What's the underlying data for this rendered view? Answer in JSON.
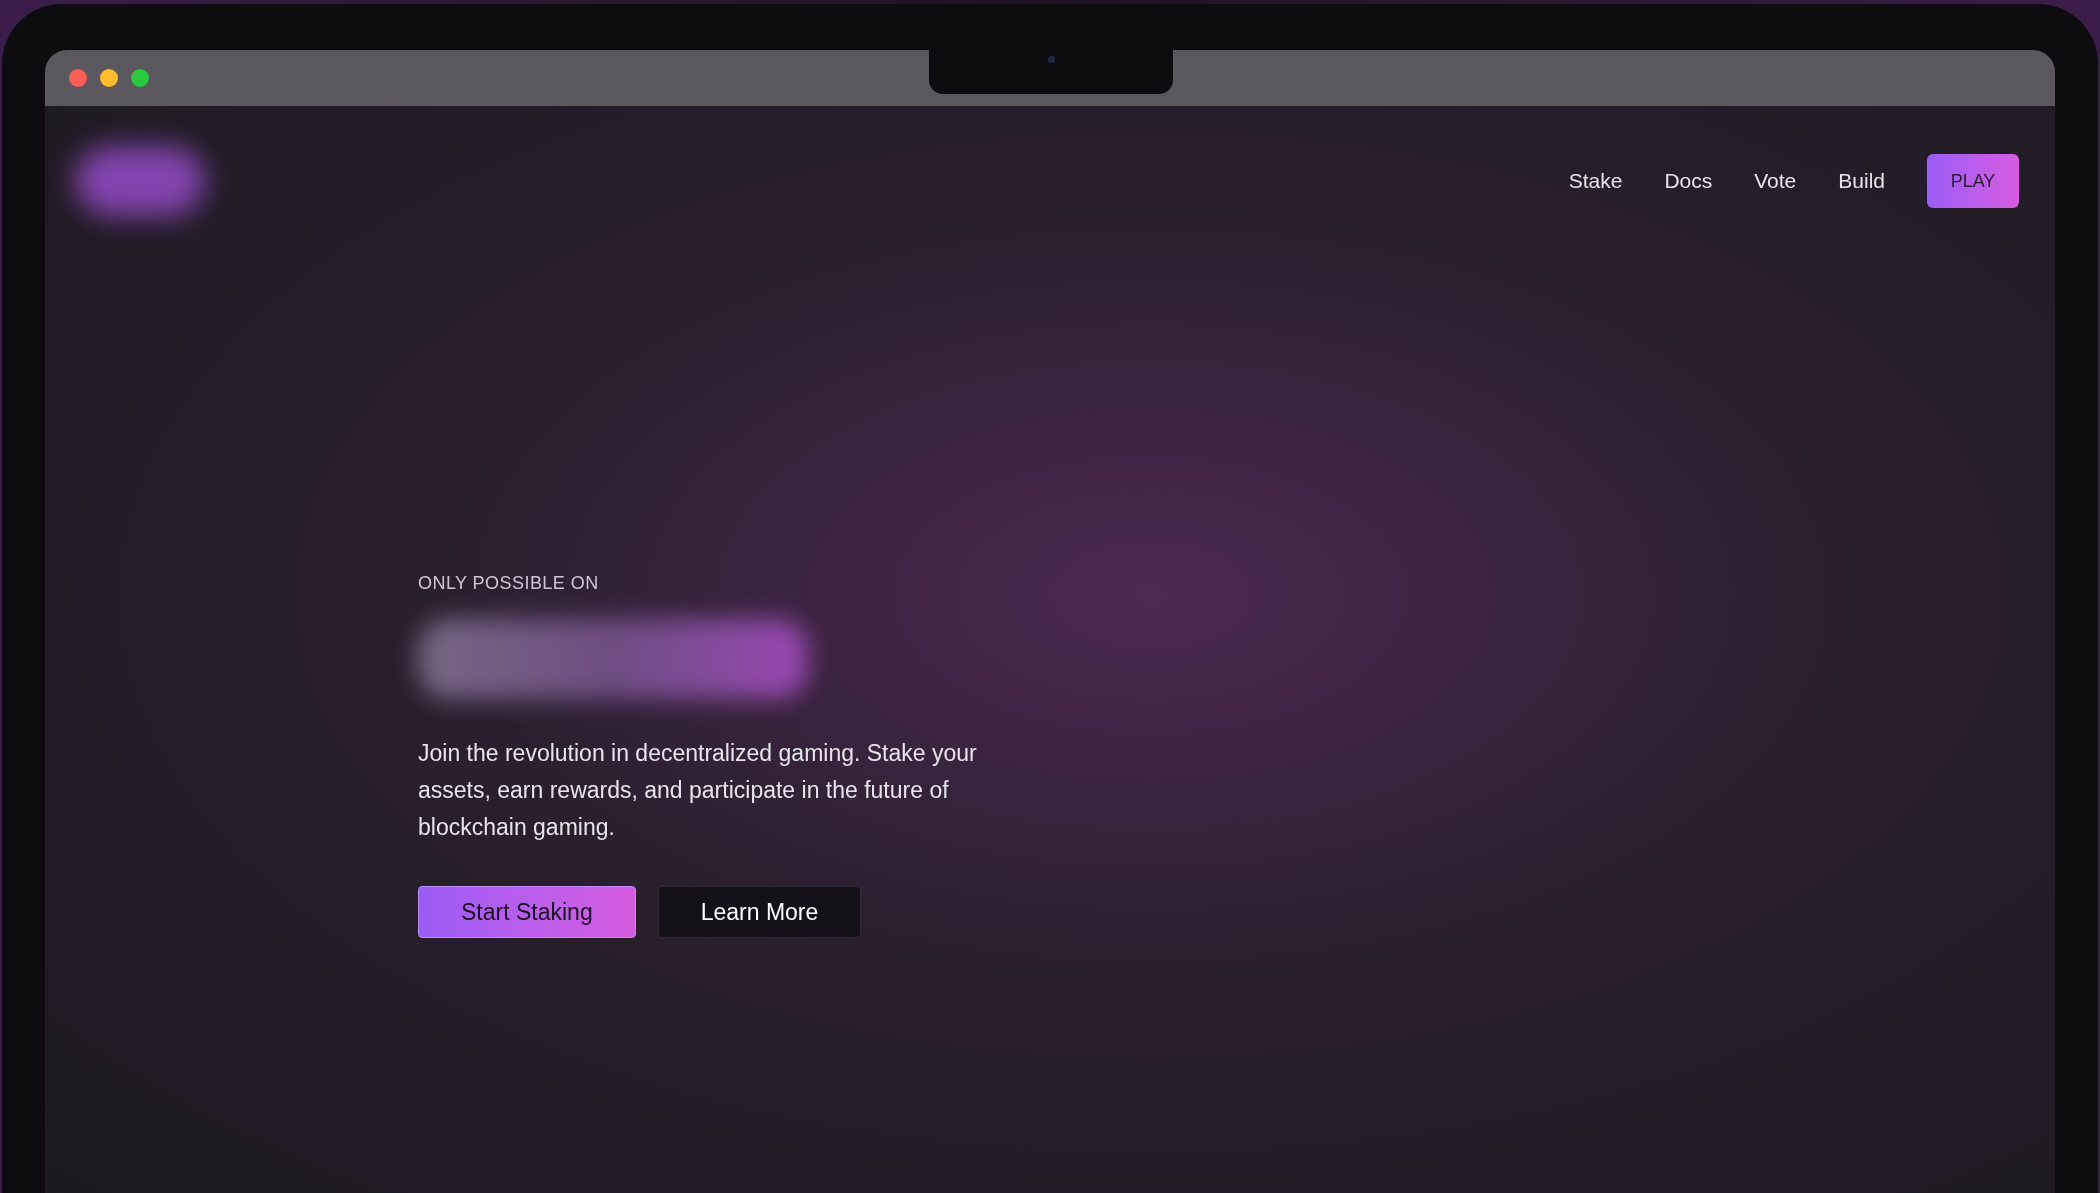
{
  "nav": {
    "links": [
      {
        "label": "Stake"
      },
      {
        "label": "Docs"
      },
      {
        "label": "Vote"
      },
      {
        "label": "Build"
      }
    ],
    "cta": "PLAY"
  },
  "hero": {
    "eyebrow": "ONLY POSSIBLE ON",
    "description": "Join the revolution in decentralized gaming. Stake your assets, earn rewards, and participate in the future of blockchain gaming.",
    "buttons": [
      {
        "label": "Start Staking",
        "kind": "primary"
      },
      {
        "label": "Learn More",
        "kind": "secondary"
      }
    ]
  }
}
